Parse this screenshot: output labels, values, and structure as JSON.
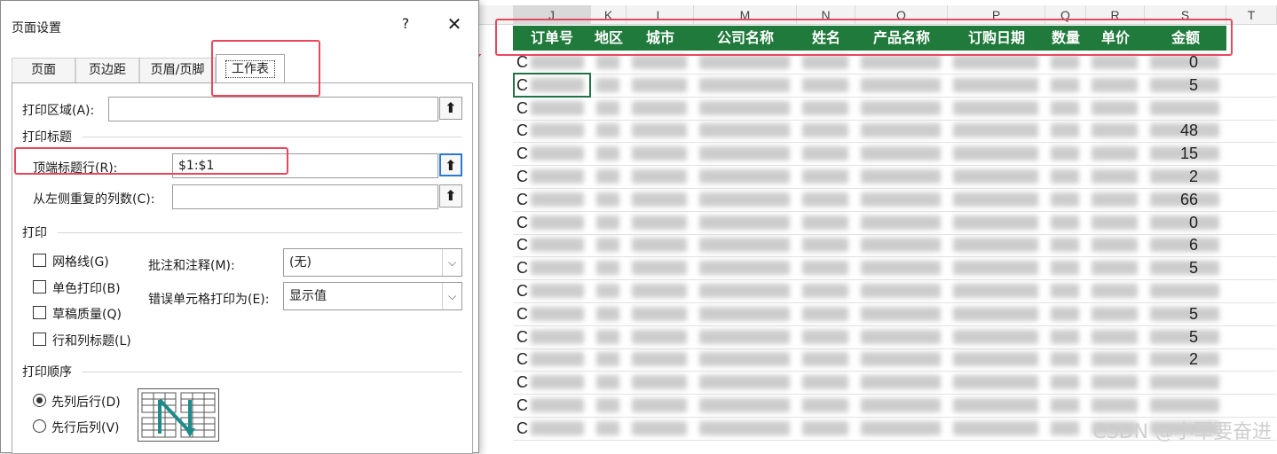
{
  "dialog": {
    "title": "页面设置",
    "help": "?",
    "close": "✕",
    "tabs": [
      {
        "label": "页面"
      },
      {
        "label": "页边距"
      },
      {
        "label": "页眉/页脚"
      },
      {
        "label": "工作表"
      }
    ],
    "print_area_label": "打印区域(A):",
    "print_area_value": "",
    "print_titles_section": "打印标题",
    "rows_to_repeat_label": "顶端标题行(R):",
    "rows_to_repeat_value": "$1:$1",
    "cols_to_repeat_label": "从左侧重复的列数(C):",
    "cols_to_repeat_value": "",
    "print_section": "打印",
    "gridlines": "网格线(G)",
    "black_white": "单色打印(B)",
    "draft": "草稿质量(Q)",
    "row_col_headings": "行和列标题(L)",
    "comments_label": "批注和注释(M):",
    "comments_value": "(无)",
    "errors_label": "错误单元格打印为(E):",
    "errors_value": "显示值",
    "order_section": "打印顺序",
    "down_then_over": "先列后行(D)",
    "over_then_down": "先行后列(V)",
    "picker_icon": "⬆"
  },
  "sheet": {
    "columns": [
      "J",
      "K",
      "L",
      "M",
      "N",
      "O",
      "P",
      "Q",
      "R",
      "S",
      "T"
    ],
    "headers": [
      "订单号",
      "地区",
      "城市",
      "公司名称",
      "姓名",
      "产品名称",
      "订购日期",
      "数量",
      "单价",
      "金额"
    ],
    "first_col_char": "C",
    "trailing": [
      "0",
      "5",
      "",
      "48",
      "15",
      "2",
      "66",
      "0",
      "6",
      "5",
      "",
      "5",
      "5",
      "2",
      "",
      "",
      ""
    ],
    "header_bg": "#1f7a3b"
  },
  "watermark": "CSDN @小军要奋进",
  "accent_red": "#e8485f"
}
